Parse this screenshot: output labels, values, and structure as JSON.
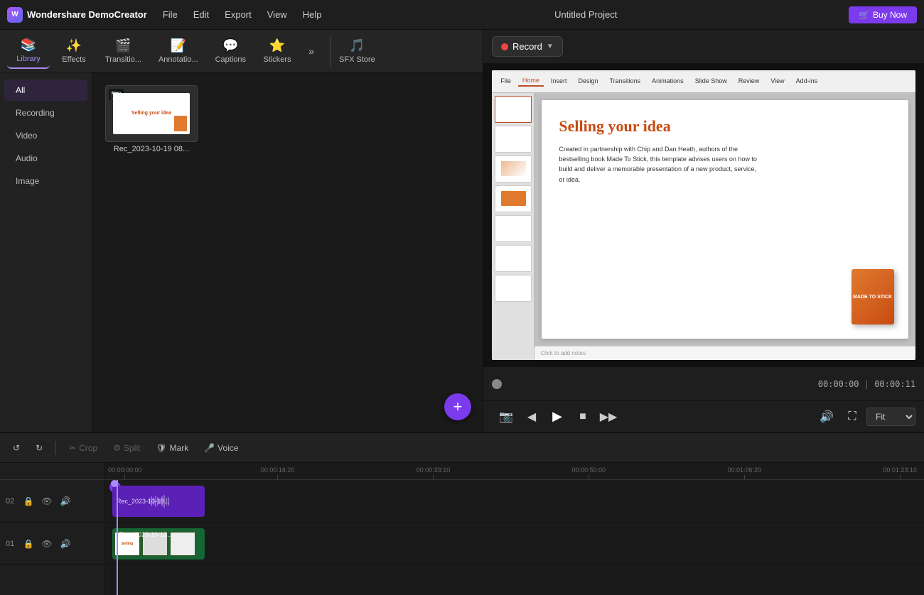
{
  "app": {
    "name": "Wondershare DemoCreator",
    "logo_letter": "W",
    "project_title": "Untitled Project"
  },
  "menubar": {
    "items": [
      "File",
      "Edit",
      "Export",
      "View",
      "Help"
    ],
    "buy_now": "Buy Now"
  },
  "toolbar": {
    "items": [
      {
        "id": "library",
        "label": "Library",
        "icon": "📚",
        "active": true
      },
      {
        "id": "effects",
        "label": "Effects",
        "icon": "✨",
        "active": false
      },
      {
        "id": "transitions",
        "label": "Transitio...",
        "icon": "🎬",
        "active": false
      },
      {
        "id": "annotations",
        "label": "Annotatio...",
        "icon": "📝",
        "active": false
      },
      {
        "id": "captions",
        "label": "Captions",
        "icon": "💬",
        "active": false
      },
      {
        "id": "stickers",
        "label": "Stickers",
        "icon": "⭐",
        "active": false
      },
      {
        "id": "sfxstore",
        "label": "SFX Store",
        "icon": "🎵",
        "active": false
      }
    ],
    "more": "»"
  },
  "sidebar": {
    "items": [
      {
        "id": "all",
        "label": "All",
        "active": true
      },
      {
        "id": "recording",
        "label": "Recording",
        "active": false
      },
      {
        "id": "video",
        "label": "Video",
        "active": false
      },
      {
        "id": "audio",
        "label": "Audio",
        "active": false
      },
      {
        "id": "image",
        "label": "Image",
        "active": false
      }
    ]
  },
  "media": {
    "items": [
      {
        "id": "rec1",
        "name": "Rec_2023-10-19 08..."
      }
    ],
    "add_button": "+"
  },
  "preview": {
    "record_label": "Record",
    "time_current": "00:00:00",
    "time_separator": "|",
    "time_total": "00:00:11",
    "fit_label": "Fit",
    "slide": {
      "title": "Selling your idea",
      "body": "Created in partnership with Chip and Dan Heath, authors of the bestselling book Made To Stick, this template advises users on how to build and deliver a memorable presentation of a new product, service, or idea.",
      "book_text": "MADE\nTO\nSTICK"
    },
    "ppt_tabs": [
      "File",
      "Home",
      "Insert",
      "Design",
      "Transitions",
      "Animations",
      "Slide Show",
      "Review",
      "View",
      "Add-ins"
    ],
    "notes_placeholder": "Click to add notes"
  },
  "timeline_toolbar": {
    "undo": "↺",
    "redo": "↻",
    "crop_label": "Crop",
    "split_label": "Split",
    "mark_label": "Mark",
    "voice_label": "Voice"
  },
  "timeline": {
    "ruler_marks": [
      {
        "time": "00:00:00:00",
        "pos": 0
      },
      {
        "time": "00:00:16:20",
        "pos": 19
      },
      {
        "time": "00:00:33:10",
        "pos": 38
      },
      {
        "time": "00:00:50:00",
        "pos": 57
      },
      {
        "time": "00:01:06:20",
        "pos": 76
      },
      {
        "time": "00:01:23:10",
        "pos": 95
      }
    ],
    "tracks": [
      {
        "num": "02",
        "clips": [
          {
            "type": "video",
            "label": "Rec_2023-10-19..."
          }
        ]
      },
      {
        "num": "01",
        "clips": [
          {
            "type": "screen",
            "label": "Rec_2023-10-19..."
          }
        ]
      }
    ]
  }
}
